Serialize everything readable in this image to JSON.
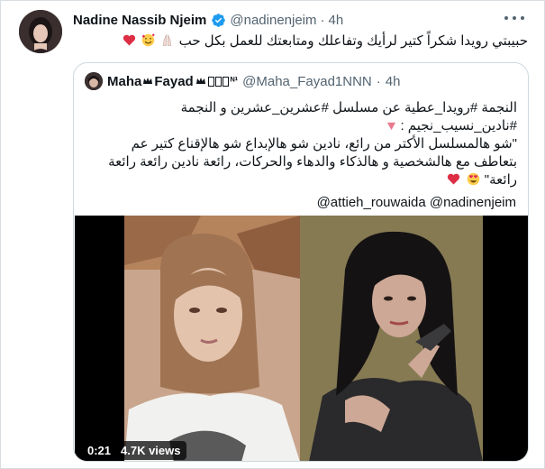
{
  "tweet": {
    "author_name": "Nadine Nassib Njeim",
    "author_handle": "@nadinenjeim",
    "separator": "·",
    "time": "4h",
    "text": "حبيبتي رويدا شكراً كتير  لرأيك وتفاعلك ومتابعتك للعمل بكل حب"
  },
  "quoted_tweet": {
    "author_name": "Maha",
    "author_name_suffix": "Fayad",
    "author_name_tail": "ᴺ¹",
    "author_handle": "@Maha_Fayad1NNN",
    "separator": "·",
    "time": "4h",
    "lines": [
      "النجمة #رويدا_عطية عن مسلسل #عشرين_عشرين و النجمة",
      "#نادين_نسيب_نجيم :",
      "\"شو هالمسلسل الأكتر من رائع، نادين شو هالإبداع شو هالإقناع كتير عم",
      "بتعاطف مع هالشخصية و هالذكاء والدهاء والحركات، رائعة نادين رائعة رائعة",
      "رائعة\""
    ],
    "mentions": "@attieh_rouwaida @nadinenjeim"
  },
  "video": {
    "duration": "0:21",
    "views": "4.7K views"
  },
  "colors": {
    "verified": "#1d9bf0",
    "secondary_text": "#536471",
    "heart": "#e0245e"
  },
  "icons": [
    "verified-badge-icon",
    "more-options-icon",
    "heart-emoji",
    "smiling-face-hearts-emoji",
    "folded-hands-emoji",
    "crown-icon",
    "heart-eyes-emoji",
    "pink-triangle-emoji"
  ]
}
